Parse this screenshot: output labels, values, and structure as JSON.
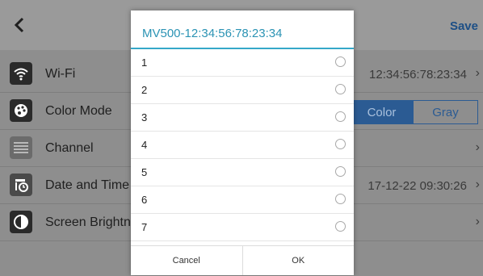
{
  "header": {
    "save_label": "Save",
    "back_icon": "back-icon"
  },
  "settings": [
    {
      "label": "Wi-Fi",
      "value": "12:34:56:78:23:34",
      "icon": "wifi-icon"
    },
    {
      "label": "Color Mode",
      "options": [
        "Color",
        "Gray"
      ],
      "selected": "Color",
      "icon": "palette-icon"
    },
    {
      "label": "Channel",
      "value": "",
      "icon": "channel-icon"
    },
    {
      "label": "Date and Time",
      "value": "17-12-22 09:30:26",
      "icon": "calendar-clock-icon"
    },
    {
      "label": "Screen Brightness",
      "value": "",
      "icon": "brightness-icon"
    }
  ],
  "dialog": {
    "title": "MV500-12:34:56:78:23:34",
    "options": [
      "1",
      "2",
      "3",
      "4",
      "5",
      "6",
      "7"
    ],
    "cancel_label": "Cancel",
    "ok_label": "OK"
  },
  "colors": {
    "accent": "#2b93b4",
    "divider": "#35a8c8",
    "selected_segment": "#2b5b93"
  }
}
